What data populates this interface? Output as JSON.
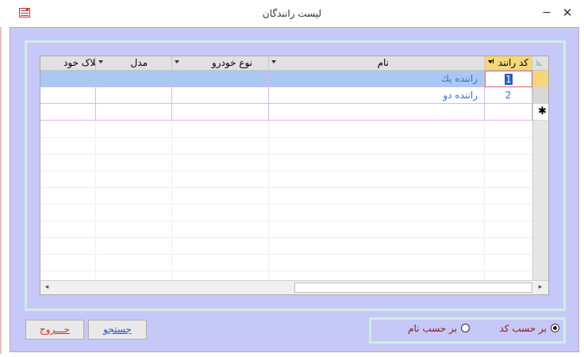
{
  "window": {
    "title": "لیست رانندگان",
    "minimize": "−",
    "close": "✕",
    "icon": "form-icon"
  },
  "grid": {
    "columns": [
      {
        "label": "كد رانند",
        "active": true
      },
      {
        "label": "نام",
        "active": false
      },
      {
        "label": "نوع خودرو",
        "active": false
      },
      {
        "label": "مدل",
        "active": false
      },
      {
        "label": "پلاک خود",
        "active": false
      }
    ],
    "rows": [
      {
        "code": "1",
        "name": "راننده یك",
        "type": "",
        "model": "",
        "plate": "",
        "selected": true
      },
      {
        "code": "2",
        "name": "راننده دو",
        "type": "",
        "model": "",
        "plate": "",
        "selected": false
      }
    ],
    "new_row_marker": "✱",
    "scroll_left": "◂",
    "scroll_right": "▸"
  },
  "buttons": {
    "exit": "خـــروج",
    "search": "جستجو"
  },
  "sort_options": {
    "by_code": {
      "label": "بر حسب كد",
      "selected": true
    },
    "by_name": {
      "label": "بر حسب نام",
      "selected": false
    }
  },
  "colors": {
    "form_background": "#c6c8f8",
    "frame_border": "#cfeee0",
    "selected_row": "#aac8f2",
    "active_header": "#f5d77a",
    "cell_text": "#3d6dcf"
  }
}
